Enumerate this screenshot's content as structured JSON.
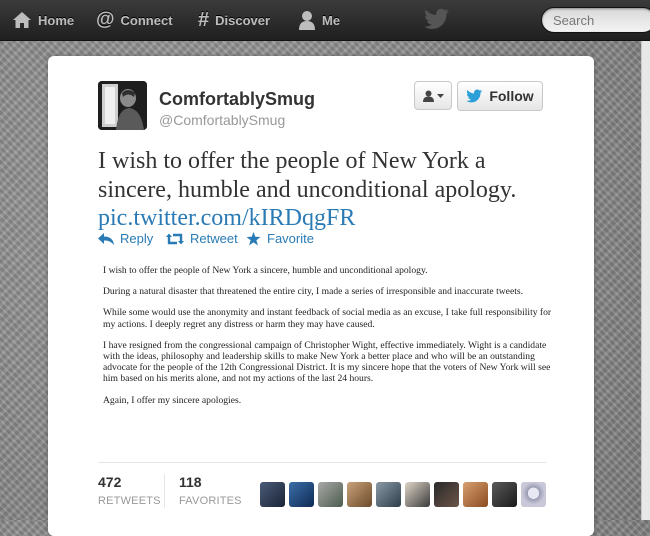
{
  "nav": {
    "home_label": "Home",
    "connect_label": "Connect",
    "discover_label": "Discover",
    "me_label": "Me",
    "search_placeholder": "Search"
  },
  "tweet": {
    "display_name": "ComfortablySmug",
    "username": "@ComfortablySmug",
    "follow_label": "Follow",
    "text": "I wish to offer the people of New York a sincere, humble and unconditional apology.",
    "link": "pic.twitter.com/kIRDqgFR",
    "actions": {
      "reply": "Reply",
      "retweet": "Retweet",
      "favorite": "Favorite"
    }
  },
  "statement": {
    "paragraphs": [
      "I wish to offer the people of New York a sincere, humble and unconditional apology.",
      "During a natural disaster that threatened the entire city, I made a series of irresponsible and inaccurate tweets.",
      "While some would use the anonymity and instant feedback of social media as an excuse, I take full responsibility for my actions.  I deeply regret any distress or harm they may have caused.",
      "I have resigned from the congressional campaign of Christopher Wight, effective immediately.  Wight is a candidate with the ideas, philosophy and leadership skills to make New York a better place and who will be an outstanding advocate for the people of the 12th Congressional District. It is my sincere hope that the voters of New York will see him based on his merits alone, and not my actions of the last 24 hours.",
      "Again, I offer my sincere apologies."
    ]
  },
  "stats": {
    "retweets_count": "472",
    "retweets_label": "RETWEETS",
    "favorites_count": "118",
    "favorites_label": "FAVORITES"
  },
  "colors": {
    "link_blue": "#2a7bb5",
    "topbar_dark": "#2b2b2b"
  },
  "icons": [
    "home-icon",
    "at-icon",
    "hash-icon",
    "person-icon",
    "twitter-bird-icon",
    "reply-icon",
    "retweet-icon",
    "star-icon"
  ]
}
